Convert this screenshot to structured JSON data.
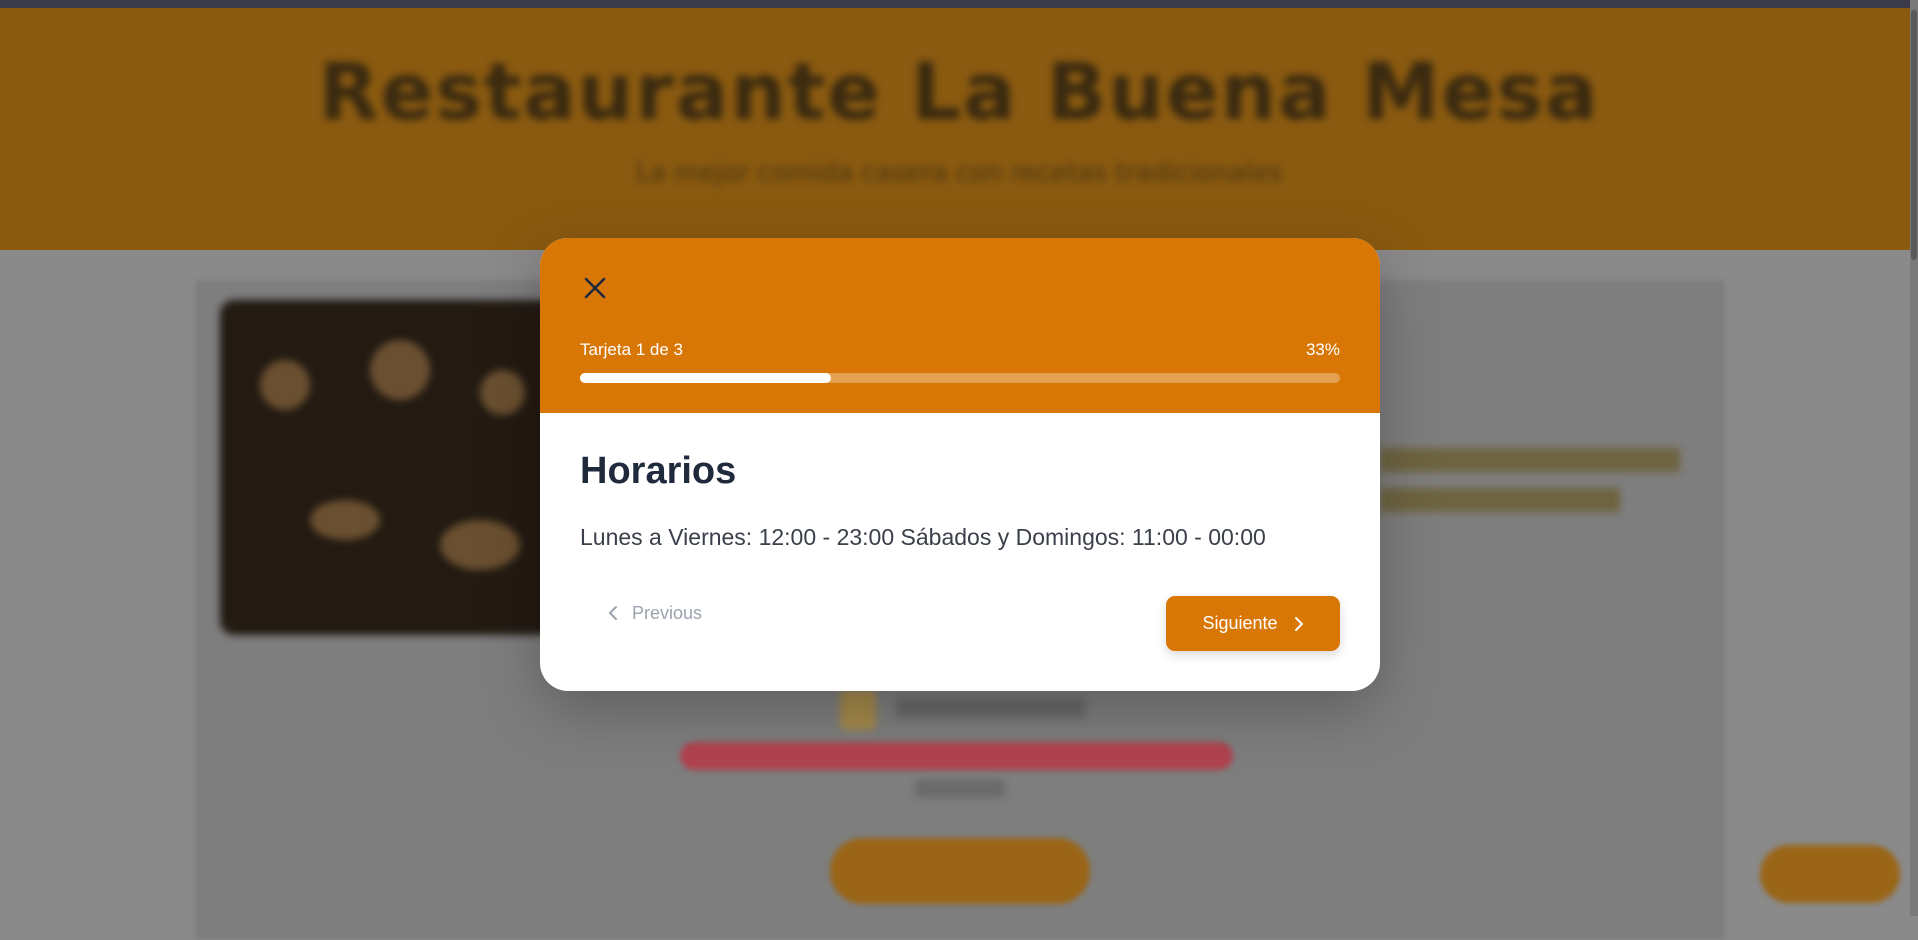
{
  "background": {
    "hero_title": "Restaurante La Buena Mesa",
    "hero_subtitle": "La mejor comida casera con recetas tradicionales"
  },
  "modal": {
    "progress": {
      "label": "Tarjeta 1 de 3",
      "percent_text": "33%",
      "fraction": 0.33
    },
    "card": {
      "title": "Horarios",
      "body": "Lunes a Viernes: 12:00 - 23:00 Sábados y Domingos: 11:00 - 00:00"
    },
    "prev_label": "Previous",
    "next_label": "Siguiente"
  },
  "colors": {
    "accent": "#d97706",
    "title": "#1f2a3d"
  },
  "icons": {
    "close": "close-icon",
    "prev": "chevron-left-icon",
    "next": "chevron-right-icon"
  }
}
